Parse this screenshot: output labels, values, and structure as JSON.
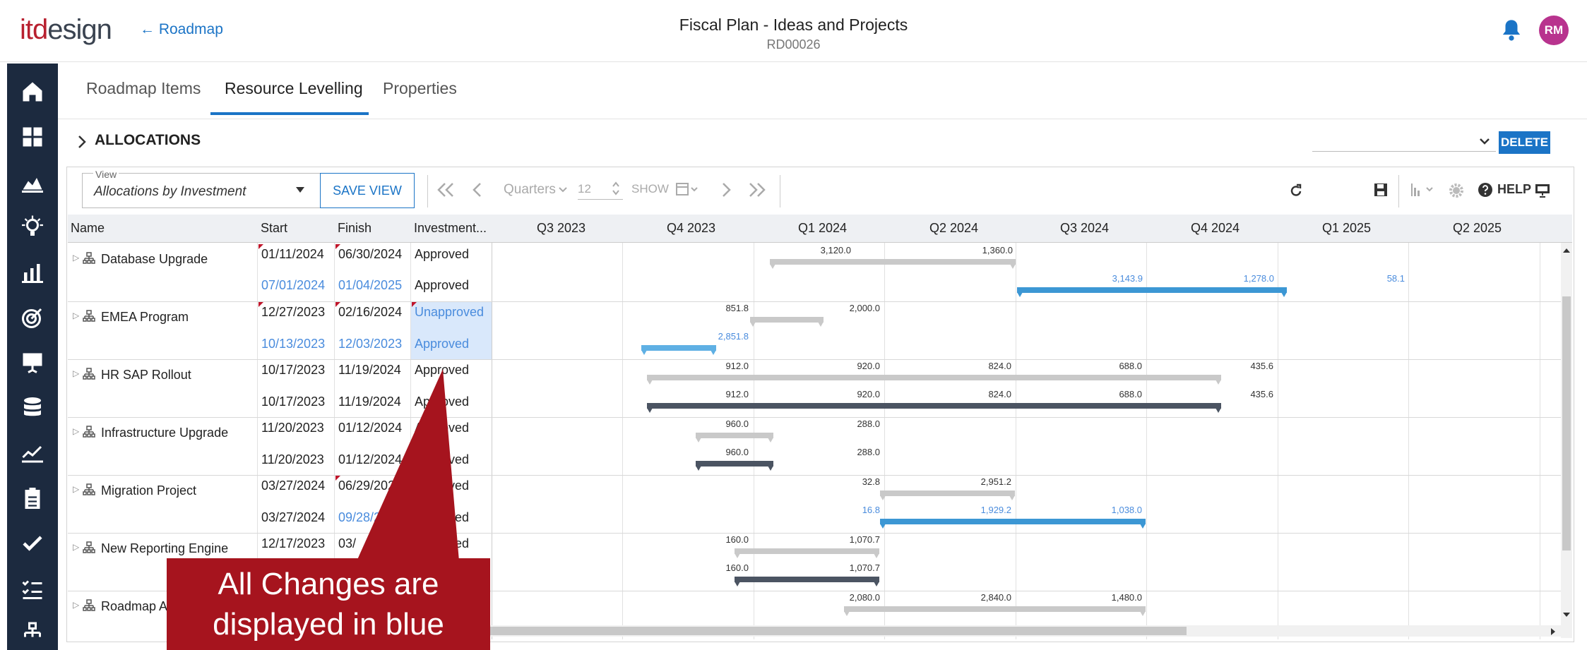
{
  "header": {
    "logo_it": "itd",
    "logo_design": "esign",
    "back_label": "← Roadmap",
    "title": "Fiscal Plan - Ideas and Projects",
    "subtitle": "RD00026",
    "avatar_initials": "RM"
  },
  "sidebar": {
    "items": [
      "home-icon",
      "dashboard-icon",
      "chart-area-icon",
      "idea-icon",
      "bar-chart-icon",
      "target-icon",
      "presentation-icon",
      "database-icon",
      "line-chart-icon",
      "clipboard-icon",
      "check-icon",
      "checklist-icon",
      "hierarchy-icon"
    ]
  },
  "tabs": [
    "Roadmap Items",
    "Resource Levelling",
    "Properties"
  ],
  "active_tab": "Resource Levelling",
  "section": {
    "title": "ALLOCATIONS",
    "delete_label": "DELETE"
  },
  "toolbar": {
    "view_label": "View",
    "view_value": "Allocations by Investment",
    "save_view_label": "SAVE VIEW",
    "period": "Quarters",
    "count": "12",
    "show_label": "SHOW",
    "help_label": "HELP"
  },
  "grid": {
    "columns": [
      "Name",
      "Start",
      "Finish",
      "Investment...",
      "Q3 2023",
      "Q4 2023",
      "Q1 2024",
      "Q2 2024",
      "Q3 2024",
      "Q4 2024",
      "Q1 2025",
      "Q2 2025"
    ],
    "rows": [
      {
        "name": "Database Upgrade",
        "start1": "01/11/2024",
        "finish1": "06/30/2024",
        "status1": "Approved",
        "start2": "07/01/2024",
        "finish2": "01/04/2025",
        "status2": "Approved"
      },
      {
        "name": "EMEA Program",
        "start1": "12/27/2023",
        "finish1": "02/16/2024",
        "status1": "Unapproved",
        "start2": "10/13/2023",
        "finish2": "12/03/2023",
        "status2": "Approved"
      },
      {
        "name": "HR SAP Rollout",
        "start1": "10/17/2023",
        "finish1": "11/19/2024",
        "status1": "Approved",
        "start2": "10/17/2023",
        "finish2": "11/19/2024",
        "status2": "Approved"
      },
      {
        "name": "Infrastructure Upgrade",
        "start1": "11/20/2023",
        "finish1": "01/12/2024",
        "status1": "Approved",
        "start2": "11/20/2023",
        "finish2": "01/12/2024",
        "status2": "Approved"
      },
      {
        "name": "Migration Project",
        "start1": "03/27/2024",
        "finish1": "06/29/2024",
        "status1": "Approved",
        "start2": "03/27/2024",
        "finish2": "09/28/2024",
        "status2": "Approved"
      },
      {
        "name": "New Reporting Engine",
        "start1": "12/17/2023",
        "finish1": "03/",
        "status1": "Approved",
        "start2": "",
        "finish2": "",
        "status2": ""
      },
      {
        "name": "Roadmap A",
        "start1": "",
        "finish1": "",
        "status1": "",
        "start2": "",
        "finish2": "",
        "status2": ""
      }
    ],
    "values": {
      "r0a": [
        "3,120.0",
        "1,360.0"
      ],
      "r0b": [
        "3,143.9",
        "1,278.0",
        "58.1"
      ],
      "r1a": [
        "851.8",
        "2,000.0"
      ],
      "r1b": [
        "2,851.8"
      ],
      "r2a": [
        "912.0",
        "920.0",
        "824.0",
        "688.0",
        "435.6"
      ],
      "r2b": [
        "912.0",
        "920.0",
        "824.0",
        "688.0",
        "435.6"
      ],
      "r3a": [
        "960.0",
        "288.0"
      ],
      "r3b": [
        "960.0",
        "288.0"
      ],
      "r4a": [
        "32.8",
        "2,951.2"
      ],
      "r4b": [
        "16.8",
        "1,929.2",
        "1,038.0"
      ],
      "r5a": [
        "160.0",
        "1,070.7"
      ],
      "r5b": [
        "160.0",
        "1,070.7"
      ],
      "r6a": [
        "2,080.0",
        "2,840.0",
        "1,480.0"
      ]
    }
  },
  "callout": {
    "line1": "All Changes are",
    "line2": "displayed in blue"
  },
  "colors": {
    "accent": "#1b74c6",
    "brand": "#b8202f",
    "sidebar": "#1c2a3f",
    "change_blue": "#4a8cdd",
    "callout": "#a6141e"
  }
}
